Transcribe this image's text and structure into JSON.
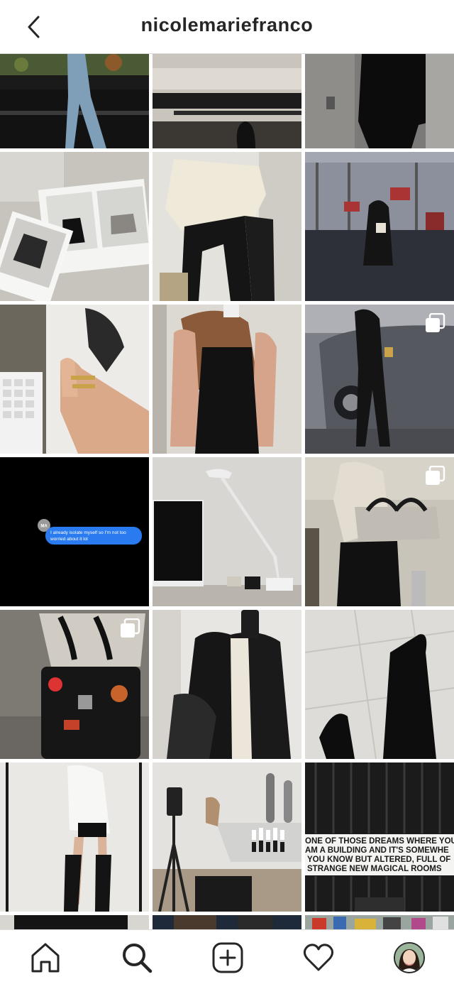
{
  "header": {
    "username": "nicolemariefranco"
  },
  "posts": {
    "message": {
      "contact_initials": "MA",
      "line1": "I already isolate myself so I'm not too",
      "line2": "worried about it lol"
    },
    "sign": {
      "line1": "ONE OF THOSE DREAMS WHERE YOU",
      "line2": "AM A BUILDING AND IT'S SOMEWHE",
      "line3": "YOU KNOW BUT ALTERED, FULL OF",
      "line4": "STRANGE NEW MAGICAL ROOMS"
    }
  },
  "tabbar": {
    "items": [
      "home-icon",
      "search-icon",
      "new-post-icon",
      "activity-icon",
      "profile-icon"
    ]
  }
}
